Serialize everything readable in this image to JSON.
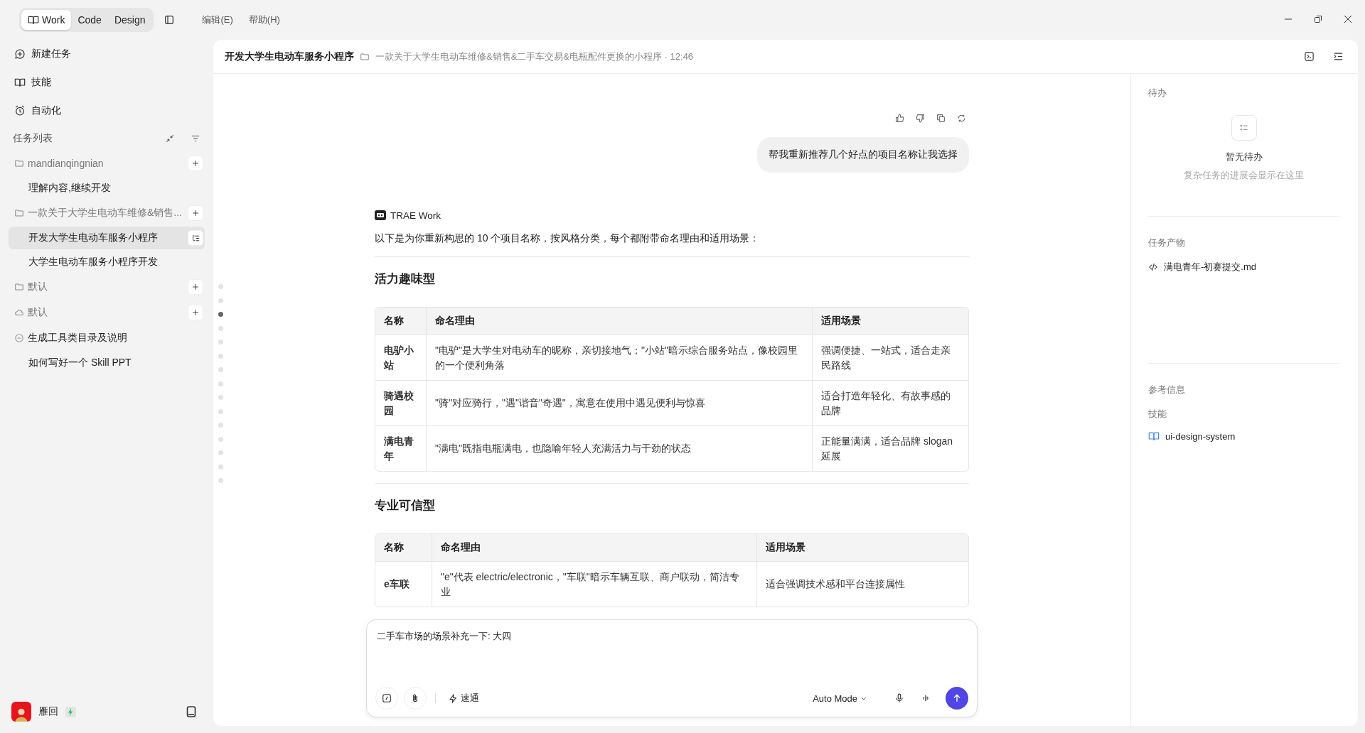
{
  "app_modes": [
    {
      "label": "Work",
      "selected": true
    },
    {
      "label": "Code",
      "selected": false
    },
    {
      "label": "Design",
      "selected": false
    }
  ],
  "menu": [
    "编辑(E)",
    "帮助(H)"
  ],
  "sidebar": {
    "nav": [
      {
        "kind": "new",
        "label": "新建任务"
      },
      {
        "kind": "skills",
        "label": "技能"
      },
      {
        "kind": "automation",
        "label": "自动化"
      }
    ],
    "task_list_title": "任务列表",
    "groups": [
      {
        "kind": "folder",
        "label": "mandianqingnian",
        "children": [
          {
            "label": "理解内容,继续开发",
            "selected": false
          }
        ]
      },
      {
        "kind": "folder",
        "label": "一款关于大学生电动车维修&销售...",
        "children": [
          {
            "label": "开发大学生电动车服务小程序",
            "selected": true
          },
          {
            "label": "大学生电动车服务小程序开发",
            "selected": false
          }
        ]
      },
      {
        "kind": "folder",
        "label": "默认"
      },
      {
        "kind": "cloud",
        "label": "默认"
      },
      {
        "kind": "task",
        "label": "生成工具类目录及说明",
        "children": [
          {
            "label": "如何写好一个 Skill PPT",
            "selected": false
          }
        ]
      }
    ],
    "user": {
      "name": "雁回"
    }
  },
  "header": {
    "title": "开发大学生电动车服务小程序",
    "project": "一款关于大学生电动车维修&销售&二手车交易&电瓶配件更换的小程序 · 12:46"
  },
  "chat": {
    "user_message": "帮我重新推荐几个好点的项目名称让我选择",
    "assistant": "TRAE Work",
    "intro": "以下是为你重新构思的 10 个项目名称，按风格分类，每个都附带命名理由和适用场景：",
    "sections": [
      {
        "heading": "活力趣味型",
        "columns": [
          "名称",
          "命名理由",
          "适用场景"
        ],
        "rows": [
          [
            "电驴小站",
            "\"电驴\"是大学生对电动车的昵称，亲切接地气；\"小站\"暗示综合服务站点，像校园里的一个便利角落",
            "强调便捷、一站式，适合走亲民路线"
          ],
          [
            "骑遇校园",
            "\"骑\"对应骑行，\"遇\"谐音\"奇遇\"，寓意在使用中遇见便利与惊喜",
            "适合打造年轻化、有故事感的品牌"
          ],
          [
            "满电青年",
            "\"满电\"既指电瓶满电，也隐喻年轻人充满活力与干劲的状态",
            "正能量满满，适合品牌 slogan 延展"
          ]
        ]
      },
      {
        "heading": "专业可信型",
        "columns": [
          "名称",
          "命名理由",
          "适用场景"
        ],
        "rows": [
          [
            "e车联",
            "\"e\"代表 electric/electronic，\"车联\"暗示车辆互联、商户联动，简洁专业",
            "适合强调技术感和平台连接属性"
          ]
        ]
      }
    ],
    "timeline": [
      {
        "selected": false
      },
      {
        "selected": false
      },
      {
        "selected": true
      },
      {
        "selected": false
      },
      {
        "selected": false
      },
      {
        "selected": false
      },
      {
        "selected": false
      },
      {
        "selected": false
      },
      {
        "selected": false
      },
      {
        "selected": false
      },
      {
        "selected": false
      },
      {
        "selected": false
      },
      {
        "selected": false
      },
      {
        "selected": false
      },
      {
        "selected": false
      }
    ]
  },
  "composer": {
    "value": "二手车市场的场景补充一下: 大四",
    "speed": "速通",
    "mode": "Auto Mode"
  },
  "right_panel": {
    "todo_title": "待办",
    "todo_empty": "暂无待办",
    "todo_hint": "复杂任务的进展会显示在这里",
    "outputs_title": "任务产物",
    "outputs": [
      "满电青年-初赛提交.md"
    ],
    "ref_title": "参考信息",
    "skills_title": "技能",
    "skills": [
      "ui-design-system"
    ]
  }
}
